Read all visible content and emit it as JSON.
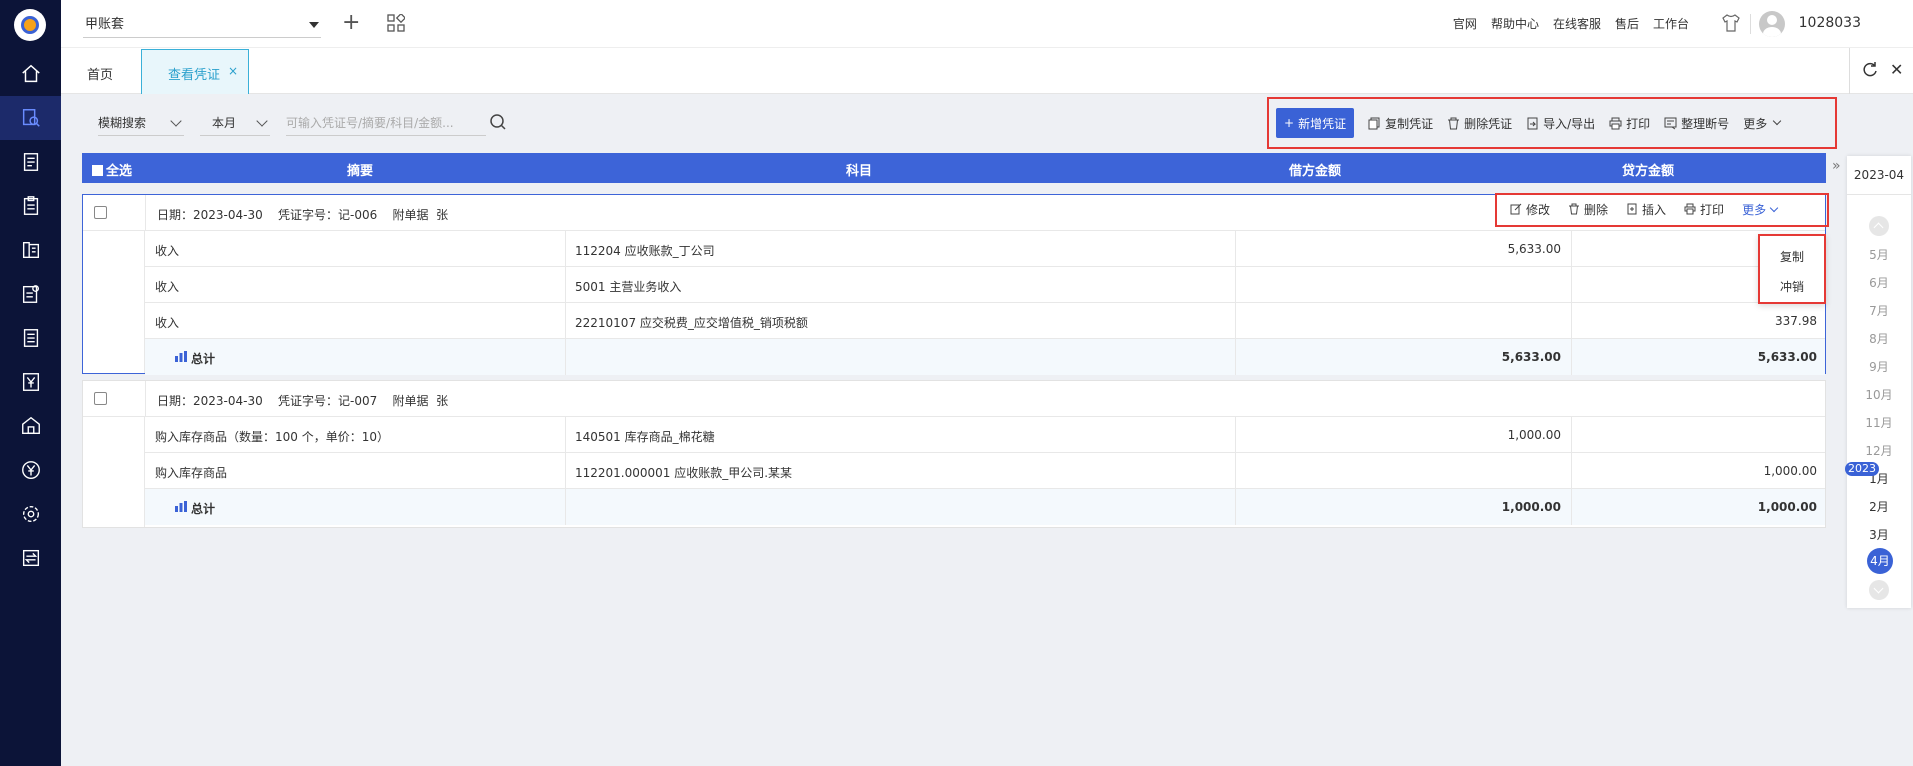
{
  "topbar": {
    "account_name": "甲账套",
    "links": [
      "官网",
      "帮助中心",
      "在线客服",
      "售后",
      "工作台"
    ],
    "user_id": "1028033"
  },
  "tabs": {
    "home": "首页",
    "active": "查看凭证",
    "close": "×"
  },
  "filters": {
    "search_mode": "模糊搜索",
    "period": "本月",
    "search_placeholder": "可输入凭证号/摘要/科目/金额..."
  },
  "toolbar": {
    "new_voucher": "新增凭证",
    "copy_voucher": "复制凭证",
    "delete_voucher": "删除凭证",
    "import_export": "导入/导出",
    "print": "打印",
    "reorder": "整理断号",
    "more": "更多"
  },
  "table_header": {
    "select_all": "全选",
    "summary": "摘要",
    "account": "科目",
    "debit": "借方金额",
    "credit": "贷方金额"
  },
  "row_actions": {
    "edit": "修改",
    "delete": "删除",
    "insert": "插入",
    "print": "打印",
    "more": "更多"
  },
  "more_menu": {
    "copy": "复制",
    "reverse": "冲销"
  },
  "vouchers": [
    {
      "header": "日期：2023-04-30    凭证字号：记-006    附单据  张",
      "rows": [
        {
          "summary": "收入",
          "account": "112204  应收账款_丁公司",
          "debit": "5,633.00",
          "credit": ""
        },
        {
          "summary": "收入",
          "account": "5001  主营业务收入",
          "debit": "",
          "credit": ""
        },
        {
          "summary": "收入",
          "account": "22210107  应交税费_应交增值税_销项税额",
          "debit": "",
          "credit": "337.98"
        }
      ],
      "total_label": "总计",
      "total_debit": "5,633.00",
      "total_credit": "5,633.00"
    },
    {
      "header": "日期：2023-04-30    凭证字号：记-007    附单据  张",
      "rows": [
        {
          "summary": "购入库存商品（数量：100 个，单价：10）",
          "account": "140501  库存商品_棉花糖",
          "debit": "1,000.00",
          "credit": ""
        },
        {
          "summary": "购入库存商品",
          "account": "112201.000001  应收账款_甲公司.某某",
          "debit": "",
          "credit": "1,000.00"
        }
      ],
      "total_label": "总计",
      "total_debit": "1,000.00",
      "total_credit": "1,000.00"
    }
  ],
  "date_panel": {
    "current": "2023-04",
    "months_before": [
      "5月",
      "6月",
      "7月",
      "8月",
      "9月",
      "10月",
      "11月",
      "12月"
    ],
    "year_badge": "2023",
    "months_after": [
      "1月",
      "2月",
      "3月"
    ],
    "active_month": "4月"
  },
  "colors": {
    "primary": "#3a62d6",
    "sidebar": "#0c1438",
    "highlight_red": "#e53935"
  }
}
